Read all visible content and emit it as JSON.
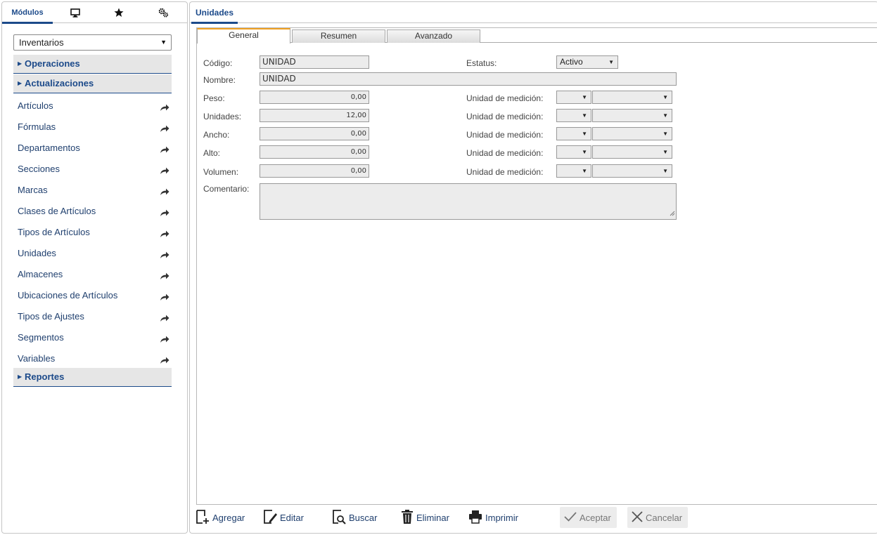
{
  "left_tabs": [
    {
      "label": "Módulos",
      "icon": null
    },
    {
      "label": null,
      "icon": "monitor-icon"
    },
    {
      "label": null,
      "icon": "star-icon"
    },
    {
      "label": null,
      "icon": "gears-icon"
    }
  ],
  "module_select": {
    "value": "Inventarios"
  },
  "sections": {
    "operaciones": "Operaciones",
    "actualizaciones": "Actualizaciones",
    "reportes": "Reportes"
  },
  "menu_items": [
    "Artículos",
    "Fórmulas",
    "Departamentos",
    "Secciones",
    "Marcas",
    "Clases de Artículos",
    "Tipos de Artículos",
    "Unidades",
    "Almacenes",
    "Ubicaciones de Artículos",
    "Tipos de Ajustes",
    "Segmentos",
    "Variables"
  ],
  "right": {
    "title": "Unidades",
    "subtabs": [
      "General",
      "Resumen",
      "Avanzado"
    ]
  },
  "form": {
    "codigo_label": "Código:",
    "codigo_value": "UNIDAD",
    "estatus_label": "Estatus:",
    "estatus_value": "Activo",
    "nombre_label": "Nombre:",
    "nombre_value": "UNIDAD",
    "measure_rows": [
      {
        "label": "Peso:",
        "value": "0,00",
        "unit_label": "Unidad de medición:"
      },
      {
        "label": "Unidades:",
        "value": "12,00",
        "unit_label": "Unidad de medición:"
      },
      {
        "label": "Ancho:",
        "value": "0,00",
        "unit_label": "Unidad de medición:"
      },
      {
        "label": "Alto:",
        "value": "0,00",
        "unit_label": "Unidad de medición:"
      },
      {
        "label": "Volumen:",
        "value": "0,00",
        "unit_label": "Unidad de medición:"
      }
    ],
    "comentario_label": "Comentario:"
  },
  "toolbar": {
    "agregar": "Agregar",
    "editar": "Editar",
    "buscar": "Buscar",
    "eliminar": "Eliminar",
    "imprimir": "Imprimir",
    "aceptar": "Aceptar",
    "cancelar": "Cancelar"
  },
  "colors": {
    "accent": "#1c4a8a",
    "active_tab_border": "#f0a020",
    "field_bg": "#ececec"
  }
}
